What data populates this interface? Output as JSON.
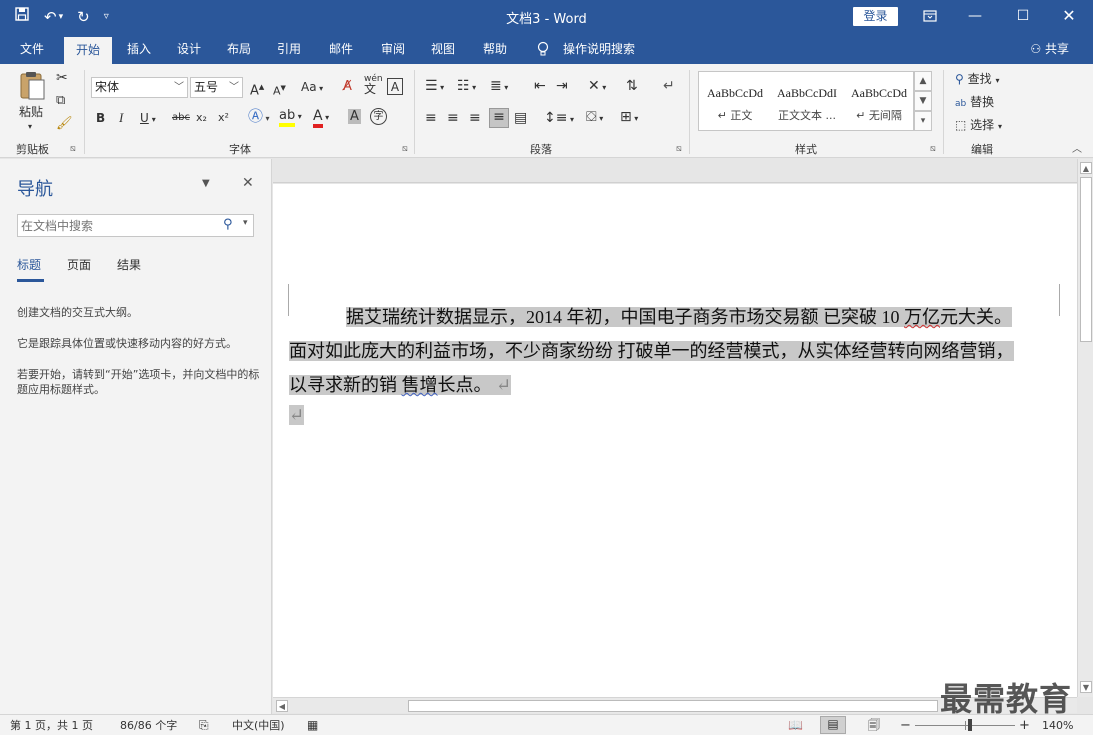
{
  "app": {
    "title": "文档3  -  Word",
    "login": "登录",
    "share": "共享"
  },
  "qat": {
    "save_icon": "save-icon",
    "undo_icon": "undo-icon",
    "redo_icon": "redo-icon",
    "customize_icon": "chevron-down-icon"
  },
  "tabs": [
    "文件",
    "开始",
    "插入",
    "设计",
    "布局",
    "引用",
    "邮件",
    "审阅",
    "视图",
    "帮助",
    "操作说明搜索"
  ],
  "ribbon": {
    "clipboard": {
      "label": "剪贴板",
      "paste": "粘贴"
    },
    "font": {
      "label": "字体",
      "font_name": "宋体",
      "font_size": "五号",
      "aa": "Aa",
      "bold": "B",
      "italic": "I",
      "underline": "U",
      "strike": "abc",
      "sub": "x₂",
      "sup": "x²",
      "phonetic": "wén",
      "border_char": "A",
      "circle_char": "字"
    },
    "paragraph": {
      "label": "段落"
    },
    "styles": {
      "label": "样式",
      "items": [
        {
          "sample": "AaBbCcDd",
          "name": "↵ 正文"
        },
        {
          "sample": "AaBbCcDdI",
          "name": "正文文本 ..."
        },
        {
          "sample": "AaBbCcDd",
          "name": "↵ 无间隔"
        }
      ]
    },
    "editing": {
      "label": "编辑",
      "find": "查找",
      "replace": "替换",
      "select": "选择"
    }
  },
  "nav": {
    "title": "导航",
    "search_placeholder": "在文档中搜索",
    "tabs": [
      "标题",
      "页面",
      "结果"
    ],
    "text1": "创建文档的交互式大纲。",
    "text2": "它是跟踪具体位置或快速移动内容的好方式。",
    "text3": "若要开始，请转到“开始”选项卡，并向文档中的标题应用标题样式。"
  },
  "document": {
    "line1_a": "据艾瑞统计数据显示，2014 年初，中国电子商务市场交易额  已突破 10 ",
    "line1_squig": "万亿",
    "line1_b": "元大关。",
    "line2": "面对如此庞大的利益市场，不少商家纷纷  打破单一的经营模式，从实体经营转向网络营销，",
    "line3_a": "以寻求新的销  ",
    "line3_squig": "售增",
    "line3_b": "长点。",
    "para_mark": "↵"
  },
  "status": {
    "page": "第 1 页，共 1 页",
    "words": "86/86 个字",
    "lang": "中文(中国)",
    "zoom": "140%",
    "minus": "−",
    "plus": "+"
  },
  "watermark": "最需教育",
  "colors": {
    "brand": "#2b579a",
    "ribbon": "#f3f3f3",
    "highlight": "#c8c8c8"
  }
}
